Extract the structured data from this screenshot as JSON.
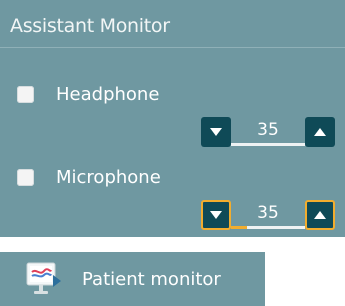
{
  "assistant_monitor": {
    "title": "Assistant Monitor",
    "headphone": {
      "label": "Headphone",
      "checked": false,
      "level": "35",
      "down_icon": "triangle-down-icon",
      "up_icon": "triangle-up-icon"
    },
    "microphone": {
      "label": "Microphone",
      "checked": false,
      "level": "35",
      "down_icon": "triangle-down-icon",
      "up_icon": "triangle-up-icon"
    }
  },
  "patient_monitor": {
    "label": "Patient monitor",
    "icon": "patient-monitor-icon"
  },
  "colors": {
    "panel_bg": "#6f98a1",
    "button_bg": "#0f4a57",
    "focus_accent": "#f2ad2e"
  }
}
